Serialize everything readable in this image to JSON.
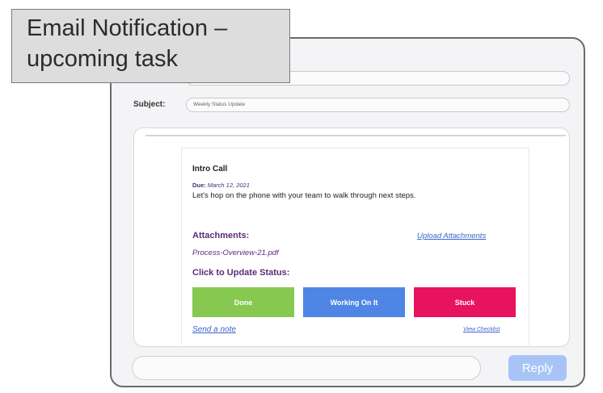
{
  "caption": {
    "line1": "Email Notification –",
    "line2": "upcoming task"
  },
  "email": {
    "to_value": "",
    "subject_label": "Subject:",
    "subject_value": "Weekly Status Update",
    "task": {
      "title": "Intro Call",
      "due_label": "Due:",
      "due_date": "March 12, 2021",
      "description": "Let's hop on the phone with your team to walk through next steps."
    },
    "attachments": {
      "heading": "Attachments:",
      "upload_link": "Upload Attachments",
      "file_name": "Process-Overview-21.pdf"
    },
    "status": {
      "heading": "Click to Update Status:",
      "buttons": [
        {
          "label": "Done",
          "color": "#86c850"
        },
        {
          "label": "Working On It",
          "color": "#4f86e6"
        },
        {
          "label": "Stuck",
          "color": "#e8135e"
        }
      ]
    },
    "links": {
      "send_note": "Send a note",
      "view_checklist": "View Checklist"
    },
    "reply": {
      "input_value": "",
      "button_label": "Reply"
    }
  },
  "colors": {
    "accent_purple": "#5c2b7a",
    "link_blue": "#3b63c9",
    "reply_button": "#a8c4f7"
  }
}
